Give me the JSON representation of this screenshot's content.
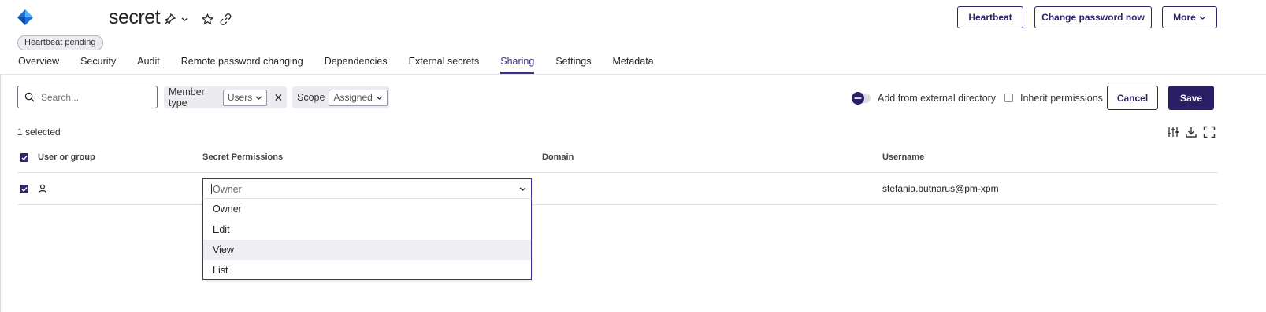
{
  "header": {
    "title": "secret",
    "status_badge": "Heartbeat pending",
    "buttons": {
      "heartbeat": "Heartbeat",
      "change_password": "Change password now",
      "more": "More"
    }
  },
  "tabs": [
    {
      "label": "Overview"
    },
    {
      "label": "Security"
    },
    {
      "label": "Audit"
    },
    {
      "label": "Remote password changing"
    },
    {
      "label": "Dependencies"
    },
    {
      "label": "External secrets"
    },
    {
      "label": "Sharing",
      "active": true
    },
    {
      "label": "Settings"
    },
    {
      "label": "Metadata"
    }
  ],
  "toolbar": {
    "search_placeholder": "Search...",
    "member_type_label": "Member type",
    "member_type_value": "Users",
    "scope_label": "Scope",
    "scope_value": "Assigned",
    "add_external": "Add from external directory",
    "inherit_permissions": "Inherit permissions",
    "cancel": "Cancel",
    "save": "Save"
  },
  "table": {
    "selected_count": "1 selected",
    "columns": [
      "User or group",
      "Secret Permissions",
      "Domain",
      "Username"
    ],
    "rows": [
      {
        "permission_value": "Owner",
        "domain": "",
        "username": "stefania.butnarus@pm-xpm"
      }
    ]
  },
  "permission_options": [
    "Owner",
    "Edit",
    "View",
    "List"
  ],
  "colors": {
    "accent": "#3b2e8c",
    "primary_button": "#2a1f66"
  }
}
